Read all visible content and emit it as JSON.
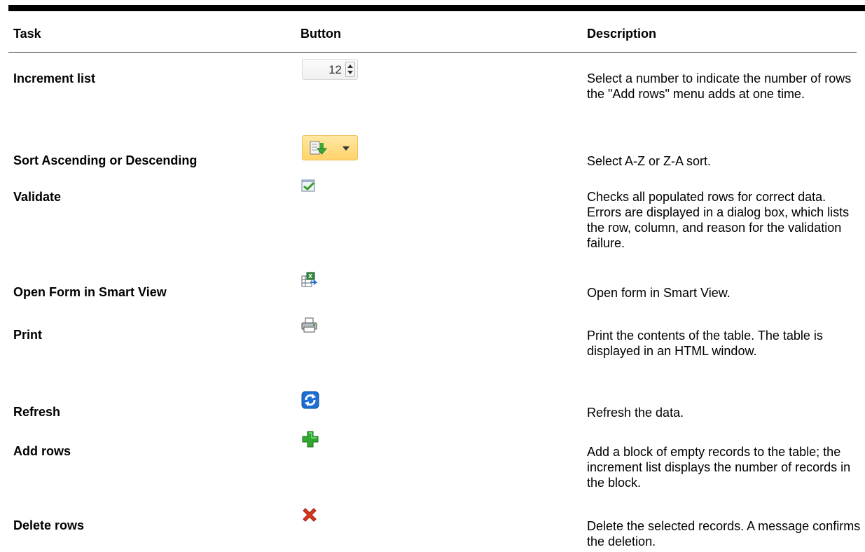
{
  "table": {
    "headers": {
      "task": "Task",
      "button": "Button",
      "description": "Description"
    },
    "rows": [
      {
        "task": "Increment list",
        "button": {
          "type": "spinner",
          "value": "12"
        },
        "description": "Select a number to indicate the number of rows the \"Add rows\" menu adds at one time."
      },
      {
        "task": "Sort Ascending or Descending",
        "button": {
          "type": "sort-dropdown",
          "icon": "sort-icon"
        },
        "description": "Select A-Z or Z-A sort."
      },
      {
        "task": "Validate",
        "button": {
          "type": "icon",
          "icon": "validate-checkmark-icon"
        },
        "description": "Checks all populated rows for correct data. Errors are displayed in a dialog box, which lists the row, column, and reason for the validation failure."
      },
      {
        "task": "Open Form in Smart View",
        "button": {
          "type": "icon",
          "icon": "smart-view-icon"
        },
        "description": "Open form in Smart View."
      },
      {
        "task": "Print",
        "button": {
          "type": "icon",
          "icon": "printer-icon"
        },
        "description": "Print the contents of the table. The table is displayed in an HTML window."
      },
      {
        "task": "Refresh",
        "button": {
          "type": "icon",
          "icon": "refresh-icon"
        },
        "description": "Refresh the data."
      },
      {
        "task": "Add rows",
        "button": {
          "type": "icon",
          "icon": "add-plus-icon"
        },
        "description": "Add a block of empty records to the table; the increment list displays the number of records in the block."
      },
      {
        "task": "Delete rows",
        "button": {
          "type": "icon",
          "icon": "delete-x-icon"
        },
        "description": "Delete the selected records. A message confirms the deletion."
      }
    ]
  },
  "colors": {
    "sort_button_bg": "#ffd36b",
    "validate_check": "#3a9a2a",
    "refresh_blue": "#1d6fd6",
    "add_green": "#2fa82f",
    "delete_red": "#e0361b"
  }
}
